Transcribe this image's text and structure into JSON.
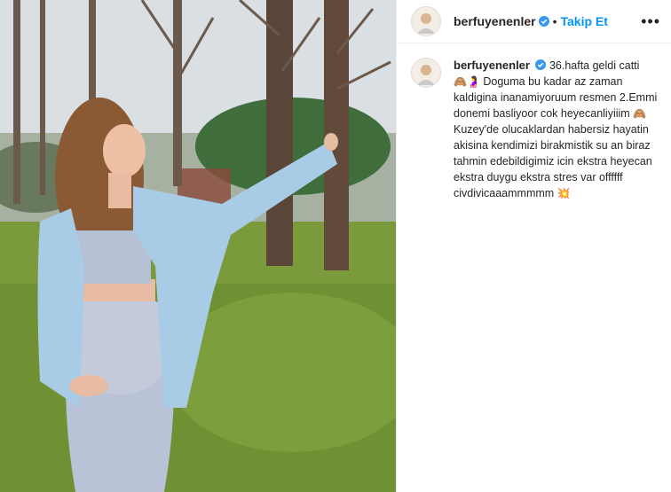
{
  "post": {
    "username": "berfuyenenler",
    "follow_label": "Takip Et",
    "separator": "•",
    "more_label": "•••",
    "caption": {
      "line1": "36.hafta geldi catti",
      "emoji1": "🙈🤰",
      "line2": "Doguma bu kadar az zaman kaldigina inanamiyoruum resmen 2.Emmi donemi basliyoor cok heyecanliyiiim",
      "emoji2": "🙈",
      "line3": "Kuzey'de olucaklardan habersiz hayatin akisina kendimizi birakmistik su an biraz tahmin edebildigimiz icin ekstra heyecan ekstra duygu ekstra stres var offffff civdivicaaammmmm",
      "emoji3": "💥"
    },
    "icons": {
      "verified": "verified-badge-icon",
      "more": "more-options-icon"
    },
    "colors": {
      "link": "#0095f6",
      "text": "#262626"
    }
  }
}
